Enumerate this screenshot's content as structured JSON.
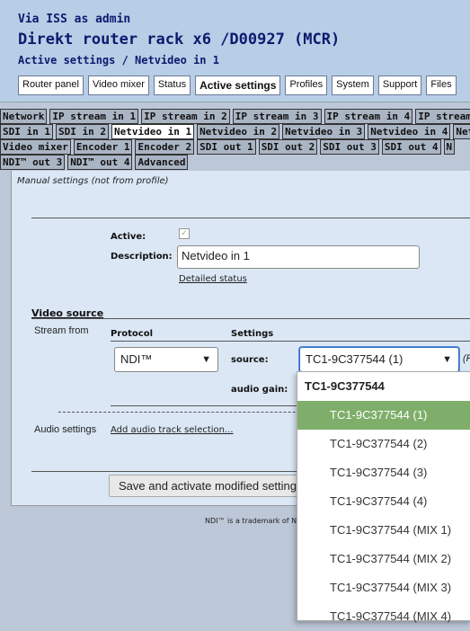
{
  "header": {
    "line1": "Via ISS as admin",
    "line2": "Direkt router rack x6 /D00927 (MCR)",
    "line3": "Active settings / Netvideo in 1"
  },
  "top_tabs": [
    "Router panel",
    "Video mixer",
    "Status",
    "Active settings",
    "Profiles",
    "System",
    "Support",
    "Files"
  ],
  "sub_tabs": {
    "row1": [
      "Network",
      "IP stream in 1",
      "IP stream in 2",
      "IP stream in 3",
      "IP stream in 4",
      "IP stream"
    ],
    "row2": [
      "SDI in 1",
      "SDI in 2",
      "Netvideo in 1",
      "Netvideo in 2",
      "Netvideo in 3",
      "Netvideo in 4",
      "Net"
    ],
    "row3": [
      "Video mixer",
      "Encoder 1",
      "Encoder 2",
      "SDI out 1",
      "SDI out 2",
      "SDI out 3",
      "SDI out 4",
      "N"
    ],
    "row4": [
      "NDI™ out 3",
      "NDI™ out 4",
      "Advanced"
    ]
  },
  "form": {
    "manual_note": "Manual settings (not from profile)",
    "active_label": "Active:",
    "description_label": "Description:",
    "description_value": "Netvideo in 1",
    "detailed_status": "Detailed status",
    "video_source": "Video source",
    "stream_from": "Stream from",
    "protocol_header": "Protocol",
    "settings_header": "Settings",
    "protocol_value": "NDI™",
    "source_label": "source:",
    "source_value": "TC1-9C377544 (1)",
    "source_suffix": "(R",
    "audio_gain_label": "audio gain:",
    "audio_settings": "Audio settings",
    "audio_link": "Add audio track selection...",
    "save_button": "Save and activate modified settings"
  },
  "footer": "NDI™ is a trademark of NewTek",
  "dropdown": {
    "group": "TC1-9C377544",
    "items": [
      "TC1-9C377544 (1)",
      "TC1-9C377544 (2)",
      "TC1-9C377544 (3)",
      "TC1-9C377544 (4)",
      "TC1-9C377544 (MIX 1)",
      "TC1-9C377544 (MIX 2)",
      "TC1-9C377544 (MIX 3)",
      "TC1-9C377544 (MIX 4)"
    ],
    "selected_index": 0
  },
  "colors": {
    "title": "#0c1a6e",
    "header_bg": "#b8cde6",
    "selected": "#7fae6a"
  }
}
